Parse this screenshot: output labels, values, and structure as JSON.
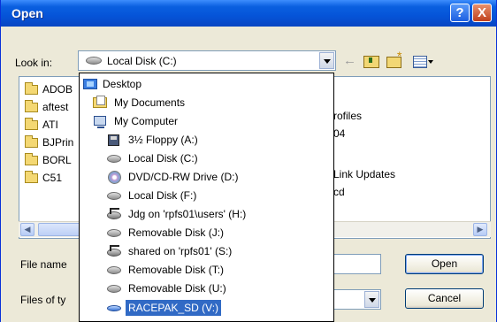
{
  "window": {
    "title": "Open",
    "help_glyph": "?",
    "close_glyph": "X"
  },
  "lookin": {
    "label": "Look in:",
    "current": "Local Disk (C:)"
  },
  "file_list": {
    "folders_col1": [
      "ADOB",
      "aftest",
      "ATI",
      "BJPrin",
      "BORL",
      "C51"
    ],
    "visible_col3": [
      "rofiles",
      "04",
      "Link Updates",
      "cd"
    ]
  },
  "dropdown": {
    "items": [
      {
        "label": "Desktop",
        "icon": "desktop-icon",
        "level": 0
      },
      {
        "label": "My Documents",
        "icon": "my-documents-icon",
        "level": 1
      },
      {
        "label": "My Computer",
        "icon": "my-computer-icon",
        "level": 1
      },
      {
        "label": "3½ Floppy (A:)",
        "icon": "floppy-icon",
        "level": 2
      },
      {
        "label": "Local Disk (C:)",
        "icon": "hard-disk-icon",
        "level": 2
      },
      {
        "label": "DVD/CD-RW Drive (D:)",
        "icon": "dvd-drive-icon",
        "level": 2
      },
      {
        "label": "Local Disk (F:)",
        "icon": "hard-disk-icon",
        "level": 2
      },
      {
        "label": "Jdg on 'rpfs01\\users' (H:)",
        "icon": "network-drive-icon",
        "level": 2
      },
      {
        "label": "Removable Disk (J:)",
        "icon": "removable-disk-icon",
        "level": 2
      },
      {
        "label": "shared on 'rpfs01' (S:)",
        "icon": "network-drive-icon",
        "level": 2
      },
      {
        "label": "Removable Disk (T:)",
        "icon": "removable-disk-icon",
        "level": 2
      },
      {
        "label": "Removable Disk (U:)",
        "icon": "removable-disk-icon",
        "level": 2
      },
      {
        "label": "RACEPAK_SD (V:)",
        "icon": "usb-drive-icon",
        "level": 2,
        "selected": true
      }
    ]
  },
  "form": {
    "file_name_label": "File name",
    "files_of_type_label": "Files of ty",
    "open_button": "Open",
    "cancel_button": "Cancel"
  },
  "colors": {
    "titlebar": "#0a5fe0",
    "dialog_bg": "#ece9d8",
    "selection": "#316ac5"
  }
}
